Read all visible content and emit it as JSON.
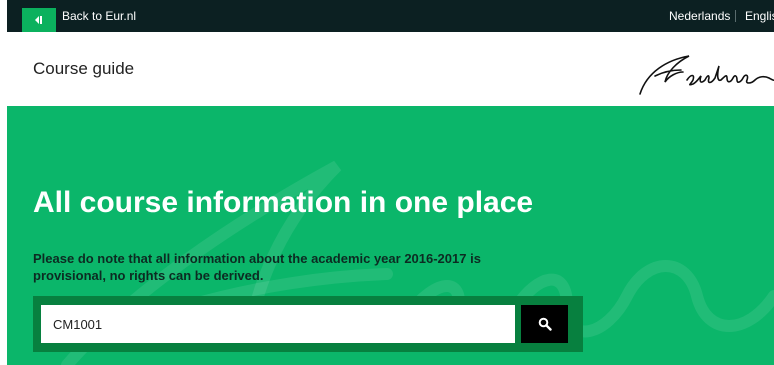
{
  "topbar": {
    "back_label": "Back to Eur.nl",
    "languages": [
      "Nederlands",
      "English"
    ]
  },
  "header": {
    "title": "Course guide"
  },
  "hero": {
    "title": "All course information in one place",
    "note": "Please do note that all information about the academic year 2016-2017 is provisional, no rights can be derived."
  },
  "search": {
    "value": "CM1001"
  },
  "colors": {
    "topbar": "#0c2022",
    "accent": "#0bb15e",
    "hero": "#0bb66a",
    "search_frame": "#07803f",
    "search_button": "#000000"
  },
  "icons": {
    "back": "back-arrow-icon",
    "search": "search-icon",
    "logo": "erasmus-logo"
  }
}
